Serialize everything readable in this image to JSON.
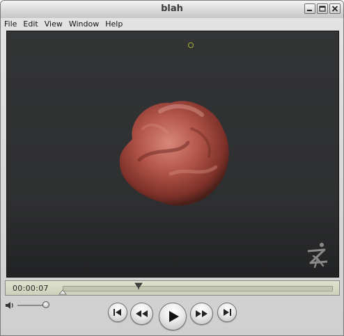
{
  "window": {
    "title": "blah"
  },
  "menu": [
    "File",
    "Edit",
    "View",
    "Window",
    "Help"
  ],
  "playback": {
    "current_time": "00:00:07",
    "position_fraction": 0.28
  },
  "volume": {
    "level_fraction": 1.0
  },
  "icons": [
    "minimize-icon",
    "maximize-icon",
    "close-icon",
    "speaker-icon",
    "skip-back-icon",
    "rewind-icon",
    "play-icon",
    "fast-forward-icon",
    "skip-forward-icon",
    "zbrush-logo"
  ],
  "colors": {
    "viewport_bg": "#303132",
    "blob": "#b4564b",
    "marker": "#a6b030"
  }
}
